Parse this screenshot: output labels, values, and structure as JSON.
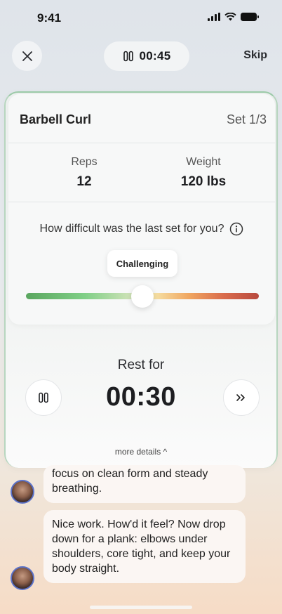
{
  "status": {
    "time": "9:41"
  },
  "top_bar": {
    "close_icon": "close-icon",
    "timer": "00:45",
    "timer_icon": "pause-icon",
    "skip_label": "Skip"
  },
  "exercise": {
    "name": "Barbell Curl",
    "set": "Set 1/3",
    "reps_label": "Reps",
    "reps_value": "12",
    "weight_label": "Weight",
    "weight_value": "120 lbs"
  },
  "difficulty": {
    "question": "How difficult was the last set for you?",
    "selected_label": "Challenging",
    "level": 0.5
  },
  "rest": {
    "label": "Rest for",
    "time": "00:30"
  },
  "more_details": "more details ^",
  "chat": [
    {
      "text": "focus on clean form and steady breathing."
    },
    {
      "text": "Nice work. How'd it feel? Now drop down for a plank: elbows under shoulders, core tight, and keep your body straight."
    }
  ],
  "colors": {
    "accent_border": "#9ccaa8",
    "slider_start": "#5aa65f",
    "slider_end": "#b84a3f"
  }
}
